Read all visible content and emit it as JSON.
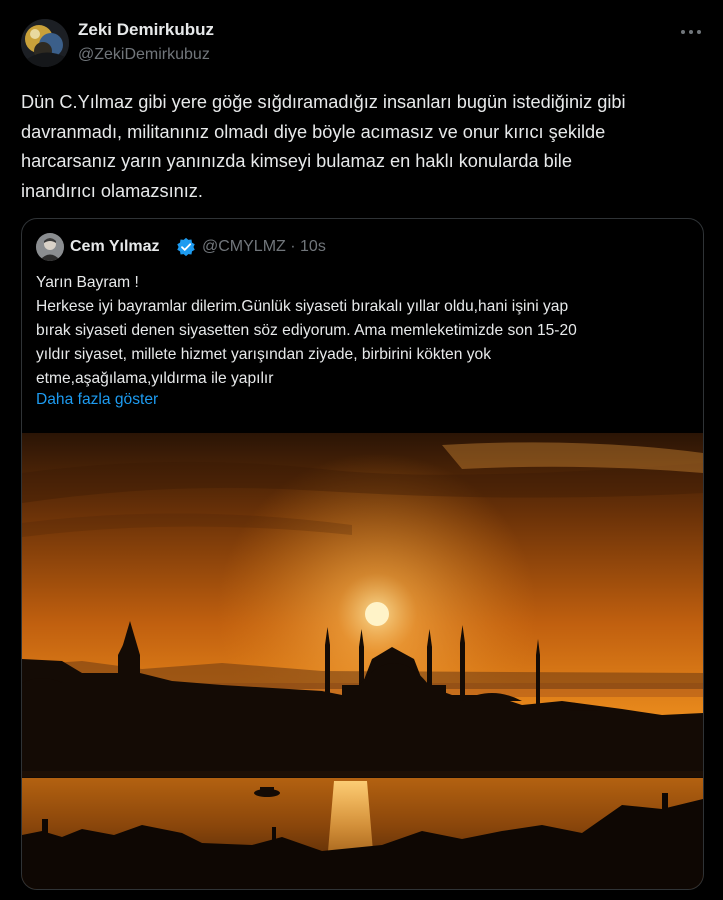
{
  "tweet": {
    "author_name": "Zeki Demirkubuz",
    "author_handle": "@ZekiDemirkubuz",
    "more_icon": "more-horizontal-icon",
    "text_lines": [
      "Dün C.Yılmaz gibi yere göğe sığdıramadığız insanları bugün istediğiniz gibi",
      "davranmadı, militanınız olmadı diye böyle acımasız ve onur kırıcı şekilde",
      "harcarsanız yarın yanınızda kimseyi bulamaz en haklı konularda bile",
      "inandırıcı olamazsınız."
    ]
  },
  "quote": {
    "author_name": "Cem Yılmaz",
    "verified_icon": "verified-badge-icon",
    "author_handle": "@CMYLMZ · 10s",
    "text_lines": [
      "Yarın Bayram !",
      "Herkese iyi bayramlar dilerim.Günlük siyaseti bırakalı yıllar oldu,hani işini yap",
      "bırak siyaseti denen siyasetten söz ediyorum. Ama memleketimizde son 15-20",
      "yıldır siyaset, millete hizmet yarışından ziyade, birbirini kökten yok",
      "etme,aşağılama,yıldırma ile yapılır"
    ],
    "show_more": "Daha fazla göster"
  },
  "colors": {
    "background": "#000000",
    "text": "#e7e9ea",
    "secondary_text": "#71767b",
    "link": "#1d9bf0",
    "border": "#2f3336"
  }
}
